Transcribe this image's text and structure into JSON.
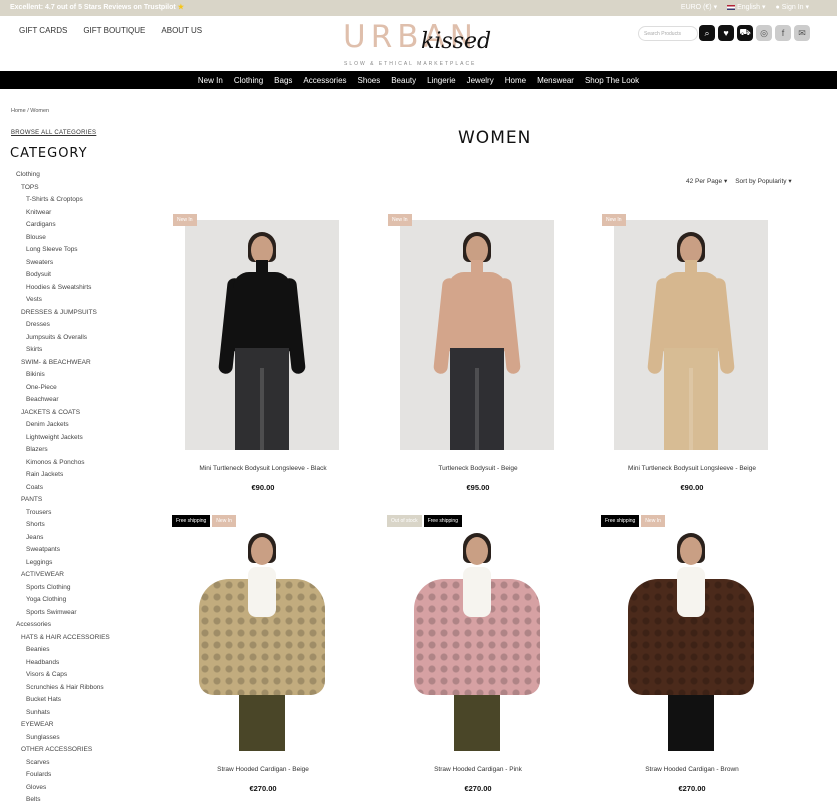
{
  "topbar": {
    "announcement": "Excellent: 4.7 out of 5 Stars Reviews on Trustpilot",
    "currency": "EURO (€)",
    "language": "English",
    "signin": "Sign In"
  },
  "header": {
    "links": [
      "GIFT CARDS",
      "GIFT BOUTIQUE",
      "ABOUT US"
    ],
    "logo_main": "URBAN",
    "logo_script": "kissed",
    "logo_tagline": "SLOW & ETHICAL MARKETPLACE",
    "search_placeholder": "Search Products",
    "icons": [
      "search-icon",
      "heart-icon",
      "cart-icon",
      "instagram-icon",
      "facebook-icon",
      "mail-icon"
    ]
  },
  "nav": [
    "New In",
    "Clothing",
    "Bags",
    "Accessories",
    "Shoes",
    "Beauty",
    "Lingerie",
    "Jewelry",
    "Home",
    "Menswear",
    "Shop The Look"
  ],
  "breadcrumb": "Home / Women",
  "sidebar": {
    "browse_all": "BROWSE ALL CATEGORIES",
    "title": "CATEGORY",
    "items": [
      {
        "label": "Clothing",
        "level": 0
      },
      {
        "label": "TOPS",
        "level": 1
      },
      {
        "label": "T-Shirts & Croptops",
        "level": 2
      },
      {
        "label": "Knitwear",
        "level": 2
      },
      {
        "label": "Cardigans",
        "level": 2
      },
      {
        "label": "Blouse",
        "level": 2
      },
      {
        "label": "Long Sleeve Tops",
        "level": 2
      },
      {
        "label": "Sweaters",
        "level": 2
      },
      {
        "label": "Bodysuit",
        "level": 2
      },
      {
        "label": "Hoodies & Sweatshirts",
        "level": 2
      },
      {
        "label": "Vests",
        "level": 2
      },
      {
        "label": "DRESSES & JUMPSUITS",
        "level": 1
      },
      {
        "label": "Dresses",
        "level": 2
      },
      {
        "label": "Jumpsuits & Overalls",
        "level": 2
      },
      {
        "label": "Skirts",
        "level": 2
      },
      {
        "label": "SWIM- & BEACHWEAR",
        "level": 1
      },
      {
        "label": "Bikinis",
        "level": 2
      },
      {
        "label": "One-Piece",
        "level": 2
      },
      {
        "label": "Beachwear",
        "level": 2
      },
      {
        "label": "JACKETS & COATS",
        "level": 1
      },
      {
        "label": "Denim Jackets",
        "level": 2
      },
      {
        "label": "Lightweight Jackets",
        "level": 2
      },
      {
        "label": "Blazers",
        "level": 2
      },
      {
        "label": "Kimonos & Ponchos",
        "level": 2
      },
      {
        "label": "Rain Jackets",
        "level": 2
      },
      {
        "label": "Coats",
        "level": 2
      },
      {
        "label": "PANTS",
        "level": 1
      },
      {
        "label": "Trousers",
        "level": 2
      },
      {
        "label": "Shorts",
        "level": 2
      },
      {
        "label": "Jeans",
        "level": 2
      },
      {
        "label": "Sweatpants",
        "level": 2
      },
      {
        "label": "Leggings",
        "level": 2
      },
      {
        "label": "ACTIVEWEAR",
        "level": 1
      },
      {
        "label": "Sports Clothing",
        "level": 2
      },
      {
        "label": "Yoga Clothing",
        "level": 2
      },
      {
        "label": "Sports Swimwear",
        "level": 2
      },
      {
        "label": "Accessories",
        "level": 0
      },
      {
        "label": "HATS & HAIR ACCESSORIES",
        "level": 1
      },
      {
        "label": "Beanies",
        "level": 2
      },
      {
        "label": "Headbands",
        "level": 2
      },
      {
        "label": "Visors & Caps",
        "level": 2
      },
      {
        "label": "Scrunchies & Hair Ribbons",
        "level": 2
      },
      {
        "label": "Bucket Hats",
        "level": 2
      },
      {
        "label": "Sunhats",
        "level": 2
      },
      {
        "label": "EYEWEAR",
        "level": 1
      },
      {
        "label": "Sunglasses",
        "level": 2
      },
      {
        "label": "OTHER ACCESSORIES",
        "level": 1
      },
      {
        "label": "Scarves",
        "level": 2
      },
      {
        "label": "Foulards",
        "level": 2
      },
      {
        "label": "Gloves",
        "level": 2
      },
      {
        "label": "Belts",
        "level": 2
      }
    ]
  },
  "main": {
    "title": "WOMEN",
    "per_page": "42 Per Page",
    "sort": "Sort by Popularity",
    "products": [
      {
        "name": "Mini Turtleneck Bodysuit Longsleeve - Black",
        "price": "€90.00",
        "badges": [
          {
            "text": "New In",
            "type": "new"
          }
        ],
        "top_color": "#111111",
        "bottom_color": "#2f2f31",
        "style": "top"
      },
      {
        "name": "Turtleneck Bodysuit - Beige",
        "price": "€95.00",
        "badges": [
          {
            "text": "New In",
            "type": "new"
          }
        ],
        "top_color": "#d3a58b",
        "bottom_color": "#2f2f33",
        "style": "top"
      },
      {
        "name": "Mini Turtleneck Bodysuit Longsleeve - Beige",
        "price": "€90.00",
        "badges": [
          {
            "text": "New In",
            "type": "new"
          }
        ],
        "top_color": "#d6b78f",
        "bottom_color": "#d7bc94",
        "style": "top"
      },
      {
        "name": "Straw Hooded Cardigan - Beige",
        "price": "€270.00",
        "badges": [
          {
            "text": "Free shipping",
            "type": "ship"
          },
          {
            "text": "New In",
            "type": "new"
          }
        ],
        "top_color": "#c2ac7e",
        "bottom_color": "#4a4628",
        "style": "coat"
      },
      {
        "name": "Straw Hooded Cardigan - Pink",
        "price": "€270.00",
        "badges": [
          {
            "text": "Out of stock",
            "type": "oos"
          },
          {
            "text": "Free shipping",
            "type": "ship"
          }
        ],
        "top_color": "#d6a1a3",
        "bottom_color": "#4a4628",
        "style": "coat"
      },
      {
        "name": "Straw Hooded Cardigan - Brown",
        "price": "€270.00",
        "badges": [
          {
            "text": "Free shipping",
            "type": "ship"
          },
          {
            "text": "New In",
            "type": "new"
          }
        ],
        "top_color": "#4b2a1b",
        "bottom_color": "#111111",
        "style": "coat"
      }
    ]
  }
}
